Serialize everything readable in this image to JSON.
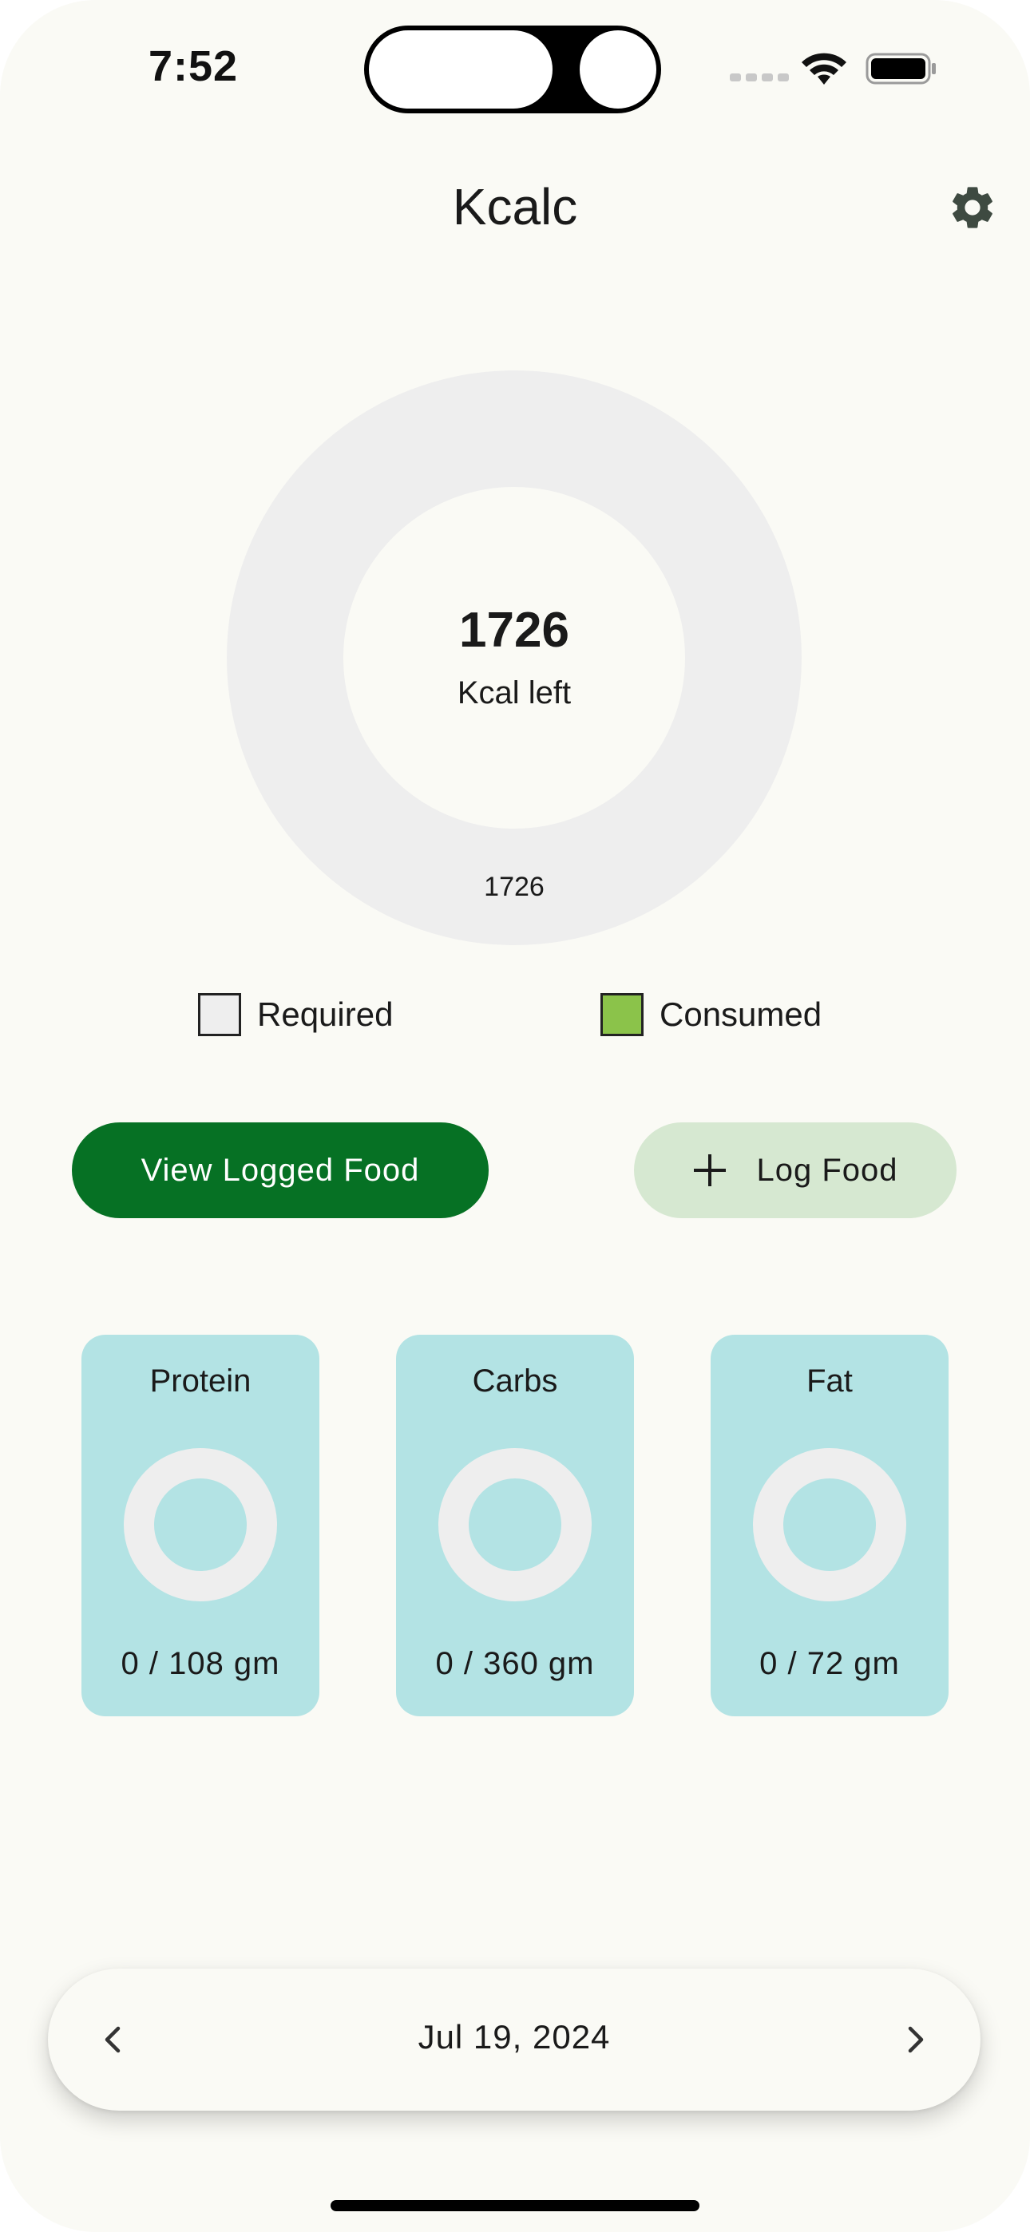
{
  "status_bar": {
    "time": "7:52"
  },
  "header": {
    "title": "Kcalc",
    "settings_icon": "gear-icon"
  },
  "calories": {
    "left_value": "1726",
    "left_label": "Kcal left",
    "ring_value": "1726",
    "consumed_fraction": 0
  },
  "legend": {
    "required_label": "Required",
    "consumed_label": "Consumed",
    "required_color": "#eeeeee",
    "consumed_color": "#8bc34a"
  },
  "actions": {
    "view_logged_food": "View Logged Food",
    "log_food": "Log Food"
  },
  "macros": [
    {
      "name": "Protein",
      "value": "0 / 108 gm",
      "consumed_fraction": 0
    },
    {
      "name": "Carbs",
      "value": "0 / 360 gm",
      "consumed_fraction": 0
    },
    {
      "name": "Fat",
      "value": "0 / 72 gm",
      "consumed_fraction": 0
    }
  ],
  "date_nav": {
    "date": "Jul 19, 2024"
  },
  "colors": {
    "background": "#fafaf5",
    "primary_button": "#067124",
    "secondary_button": "#d6e8d1",
    "card": "#b3e3e4",
    "ring_track": "#eeeeee"
  }
}
